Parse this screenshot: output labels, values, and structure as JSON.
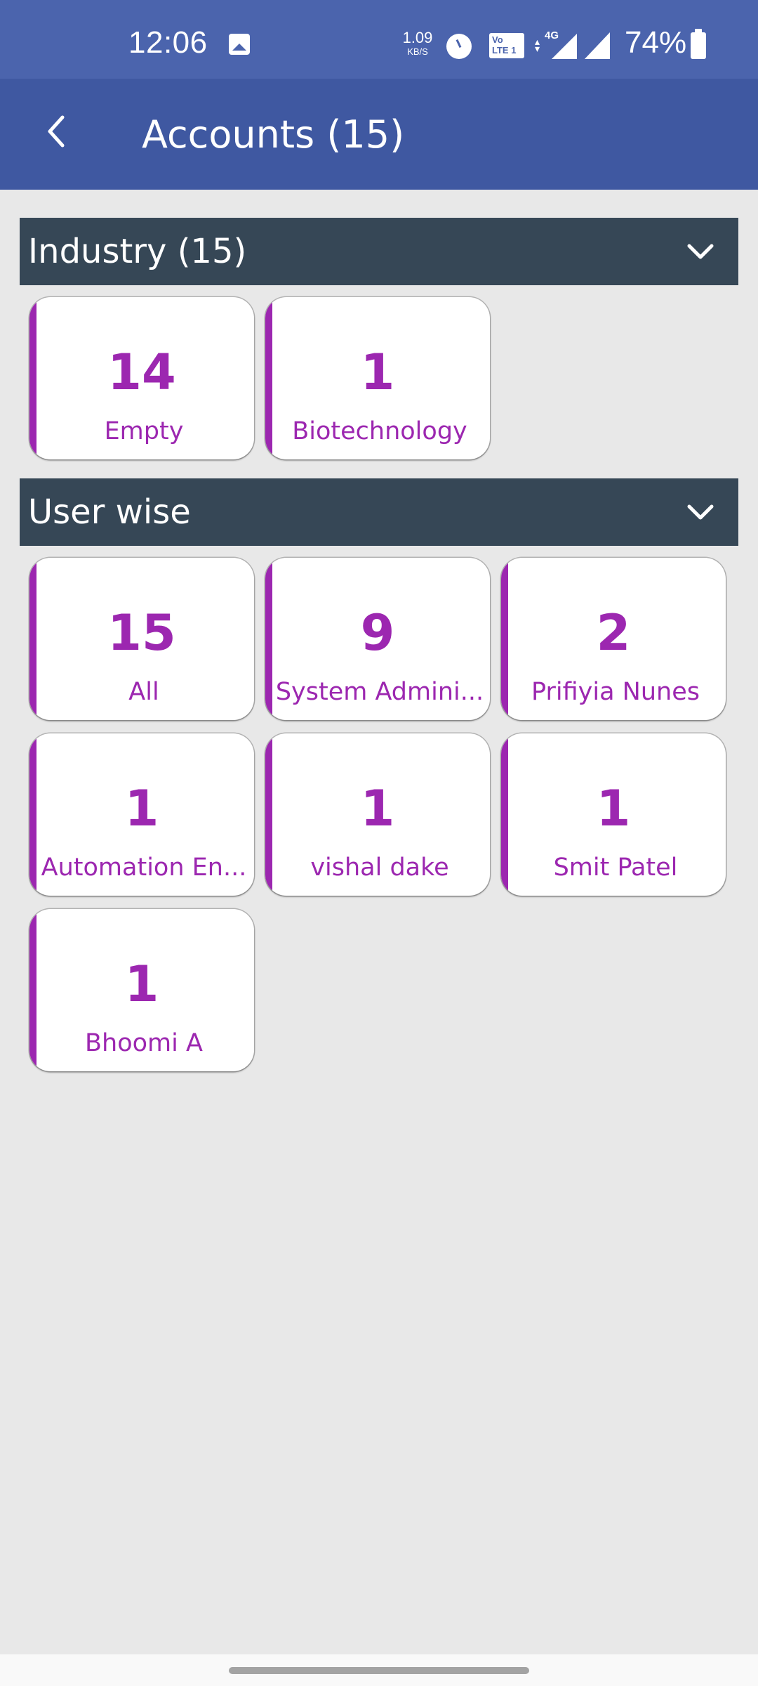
{
  "status_bar": {
    "time": "12:06",
    "net_speed_value": "1.09",
    "net_speed_unit": "KB/S",
    "volte_line1": "Vo",
    "volte_line2": "LTE 1",
    "network_type": "4G",
    "battery_percent": "74%",
    "icons": [
      "gallery-icon",
      "alarm-icon",
      "volte-icon",
      "signal-4g-icon",
      "signal-icon",
      "battery-icon"
    ]
  },
  "app_bar": {
    "back_icon": "chevron-left-icon",
    "title": "Accounts (15)"
  },
  "sections": [
    {
      "title": "Industry (15)",
      "expand_icon": "chevron-down-icon",
      "cards": [
        {
          "count": "14",
          "label": "Empty"
        },
        {
          "count": "1",
          "label": "Biotechnology"
        }
      ]
    },
    {
      "title": "User wise",
      "expand_icon": "chevron-down-icon",
      "cards": [
        {
          "count": "15",
          "label": "All"
        },
        {
          "count": "9",
          "label": "System Admini..."
        },
        {
          "count": "2",
          "label": "Prifiyia Nunes"
        },
        {
          "count": "1",
          "label": "Automation En..."
        },
        {
          "count": "1",
          "label": "vishal dake"
        },
        {
          "count": "1",
          "label": "Smit Patel"
        },
        {
          "count": "1",
          "label": "Bhoomi A"
        }
      ]
    }
  ],
  "colors": {
    "status_bar": "#4b64ad",
    "app_bar": "#3f58a1",
    "section_header": "#364756",
    "accent": "#9c27b0",
    "background": "#e8e8e8"
  }
}
